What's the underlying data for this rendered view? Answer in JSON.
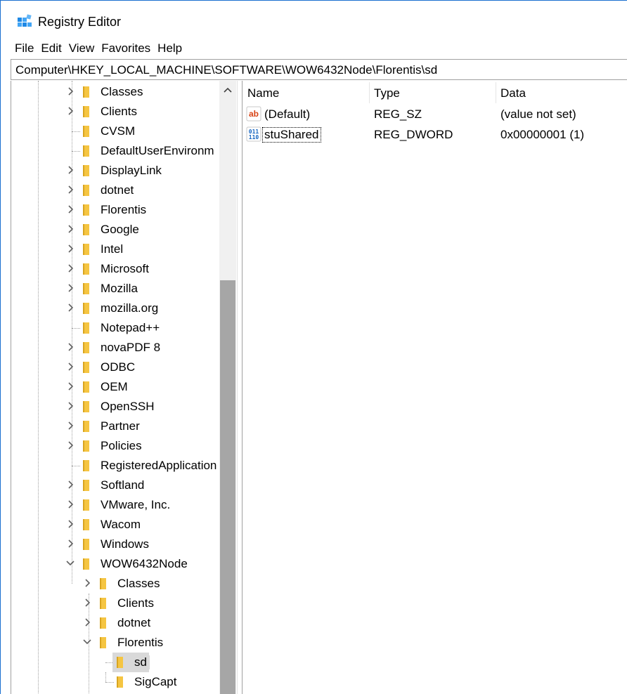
{
  "window": {
    "title": "Registry Editor"
  },
  "menu": [
    "File",
    "Edit",
    "View",
    "Favorites",
    "Help"
  ],
  "address": "Computer\\HKEY_LOCAL_MACHINE\\SOFTWARE\\WOW6432Node\\Florentis\\sd",
  "tree": [
    {
      "label": "Classes",
      "level": 0,
      "expander": "collapsed"
    },
    {
      "label": "Clients",
      "level": 0,
      "expander": "collapsed"
    },
    {
      "label": "CVSM",
      "level": 0,
      "expander": "none"
    },
    {
      "label": "DefaultUserEnvironm",
      "level": 0,
      "expander": "none"
    },
    {
      "label": "DisplayLink",
      "level": 0,
      "expander": "collapsed"
    },
    {
      "label": "dotnet",
      "level": 0,
      "expander": "collapsed"
    },
    {
      "label": "Florentis",
      "level": 0,
      "expander": "collapsed"
    },
    {
      "label": "Google",
      "level": 0,
      "expander": "collapsed"
    },
    {
      "label": "Intel",
      "level": 0,
      "expander": "collapsed"
    },
    {
      "label": "Microsoft",
      "level": 0,
      "expander": "collapsed"
    },
    {
      "label": "Mozilla",
      "level": 0,
      "expander": "collapsed"
    },
    {
      "label": "mozilla.org",
      "level": 0,
      "expander": "collapsed"
    },
    {
      "label": "Notepad++",
      "level": 0,
      "expander": "none"
    },
    {
      "label": "novaPDF 8",
      "level": 0,
      "expander": "collapsed"
    },
    {
      "label": "ODBC",
      "level": 0,
      "expander": "collapsed"
    },
    {
      "label": "OEM",
      "level": 0,
      "expander": "collapsed"
    },
    {
      "label": "OpenSSH",
      "level": 0,
      "expander": "collapsed"
    },
    {
      "label": "Partner",
      "level": 0,
      "expander": "collapsed"
    },
    {
      "label": "Policies",
      "level": 0,
      "expander": "collapsed"
    },
    {
      "label": "RegisteredApplication",
      "level": 0,
      "expander": "none"
    },
    {
      "label": "Softland",
      "level": 0,
      "expander": "collapsed"
    },
    {
      "label": "VMware, Inc.",
      "level": 0,
      "expander": "collapsed"
    },
    {
      "label": "Wacom",
      "level": 0,
      "expander": "collapsed"
    },
    {
      "label": "Windows",
      "level": 0,
      "expander": "collapsed"
    },
    {
      "label": "WOW6432Node",
      "level": 0,
      "expander": "expanded"
    },
    {
      "label": "Classes",
      "level": 1,
      "expander": "collapsed"
    },
    {
      "label": "Clients",
      "level": 1,
      "expander": "collapsed"
    },
    {
      "label": "dotnet",
      "level": 1,
      "expander": "collapsed"
    },
    {
      "label": "Florentis",
      "level": 1,
      "expander": "expanded"
    },
    {
      "label": "sd",
      "level": 2,
      "expander": "none",
      "selected": true
    },
    {
      "label": "SigCapt",
      "level": 2,
      "expander": "none"
    }
  ],
  "columns": [
    "Name",
    "Type",
    "Data"
  ],
  "values": [
    {
      "icon": "string-value-icon",
      "name": "(Default)",
      "type": "REG_SZ",
      "data": "(value not set)"
    },
    {
      "icon": "dword-value-icon",
      "name": "stuShared",
      "type": "REG_DWORD",
      "data": "0x00000001 (1)",
      "focused": true
    }
  ],
  "colors": {
    "border_accent": "#1a6fd0",
    "folder": "#f5c542",
    "selection": "#d9d9d9",
    "scroll_thumb": "#a6a6a6"
  }
}
